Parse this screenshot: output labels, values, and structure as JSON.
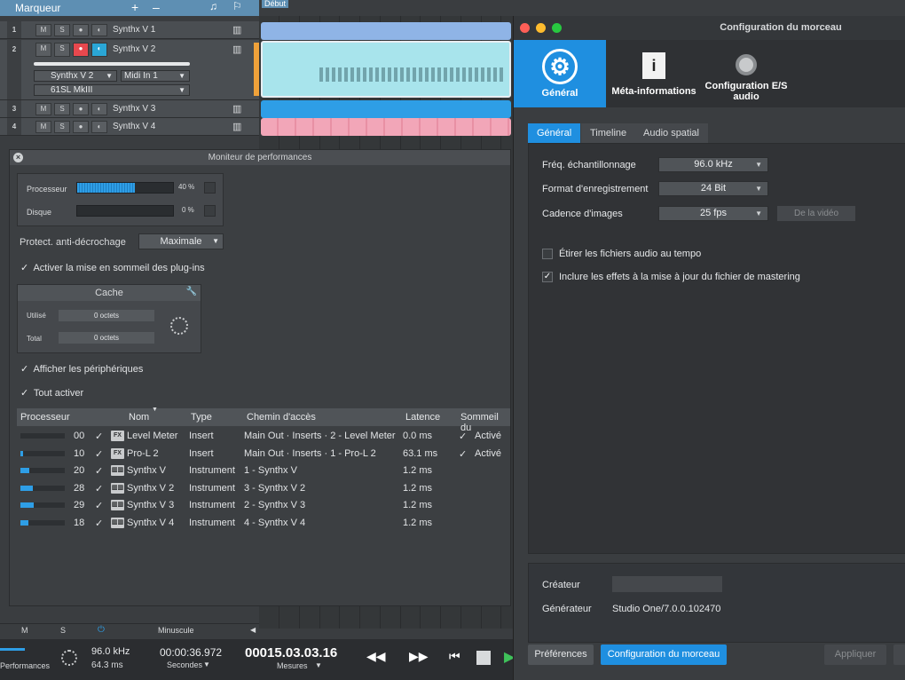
{
  "marker": {
    "label": "Marqueur",
    "plus": "+",
    "minus": "–",
    "debut": "Début"
  },
  "tracks": [
    {
      "num": "1",
      "name": "Synthx V 1",
      "m": "M",
      "s": "S"
    },
    {
      "num": "2",
      "name": "Synthx V 2",
      "m": "M",
      "s": "S",
      "instrument": "Synthx V 2",
      "midi": "Midi In 1",
      "device": "61SL MkIII"
    },
    {
      "num": "3",
      "name": "Synthx V 3",
      "m": "M",
      "s": "S"
    },
    {
      "num": "4",
      "name": "Synthx V 4",
      "m": "M",
      "s": "S"
    }
  ],
  "perf": {
    "title": "Moniteur de performances",
    "cpu_label": "Processeur",
    "cpu_value": "40 %",
    "cpu_level": 0.6,
    "disk_label": "Disque",
    "disk_value": "0 %",
    "dropout_label": "Protect. anti-décrochage",
    "dropout_value": "Maximale",
    "sleep_label": "Activer la mise en sommeil des plug-ins",
    "cache_title": "Cache",
    "cache_used_label": "Utilisé",
    "cache_used_value": "0 octets",
    "cache_total_label": "Total",
    "cache_total_value": "0 octets",
    "show_devices": "Afficher les périphériques",
    "enable_all": "Tout activer",
    "columns": [
      "Processeur",
      "Nom",
      "Type",
      "Chemin d'accès",
      "Latence",
      "Sommeil du"
    ],
    "rows": [
      {
        "cpu": "00",
        "level": 0.0,
        "icon": "FX",
        "name": "Level Meter",
        "type": "Insert",
        "path": "Main Out · Inserts · 2 - Level Meter",
        "latency": "0.0 ms",
        "sleep": "Activé"
      },
      {
        "cpu": "10",
        "level": 0.05,
        "icon": "FX",
        "name": "Pro-L 2",
        "type": "Insert",
        "path": "Main Out · Inserts · 1 - Pro-L 2",
        "latency": "63.1 ms",
        "sleep": "Activé"
      },
      {
        "cpu": "20",
        "level": 0.2,
        "icon": "kbd",
        "name": "Synthx V",
        "type": "Instrument",
        "path": "1 - Synthx V",
        "latency": "1.2 ms",
        "sleep": ""
      },
      {
        "cpu": "28",
        "level": 0.28,
        "icon": "kbd",
        "name": "Synthx V 2",
        "type": "Instrument",
        "path": "3 - Synthx V 2",
        "latency": "1.2 ms",
        "sleep": ""
      },
      {
        "cpu": "29",
        "level": 0.29,
        "icon": "kbd",
        "name": "Synthx V 3",
        "type": "Instrument",
        "path": "2 - Synthx V 3",
        "latency": "1.2 ms",
        "sleep": ""
      },
      {
        "cpu": "18",
        "level": 0.18,
        "icon": "kbd",
        "name": "Synthx V 4",
        "type": "Instrument",
        "path": "4 - Synthx V 4",
        "latency": "1.2 ms",
        "sleep": ""
      }
    ]
  },
  "mixbar": {
    "m": "M",
    "s": "S",
    "size": "Minuscule"
  },
  "transport": {
    "perf_label": "Performances",
    "rate": "96.0 kHz",
    "latency": "64.3 ms",
    "time": "00:00:36.972",
    "time_unit": "Secondes",
    "bars": "00015.03.03.16",
    "bars_unit": "Mesures"
  },
  "cfg": {
    "title": "Configuration du morceau",
    "tab_general": "Général",
    "tab_meta": "Méta-informations",
    "tab_io": "Configuration E/S audio",
    "sub_general": "Général",
    "sub_timeline": "Timeline",
    "sub_spatial": "Audio spatial",
    "rate_label": "Fréq. échantillonnage",
    "rate_value": "96.0 kHz",
    "format_label": "Format d'enregistrement",
    "format_value": "24 Bit",
    "fps_label": "Cadence d'images",
    "fps_value": "25 fps",
    "from_video": "De la vidéo",
    "stretch_label": "Étirer les fichiers audio au tempo",
    "effects_label": "Inclure les effets à la mise à jour du fichier de mastering",
    "creator_label": "Créateur",
    "creator_value": "",
    "generator_label": "Générateur",
    "generator_value": "Studio One/7.0.0.102470",
    "prefs_btn": "Préférences",
    "song_btn": "Configuration du morceau",
    "apply_btn": "Appliquer"
  },
  "colors": {
    "accent": "#1f8fe0",
    "track_blue": "#8fb4e6",
    "track_cyan": "#a8e4ec",
    "track_pink": "#f2a6b8",
    "record": "#e8484e"
  }
}
